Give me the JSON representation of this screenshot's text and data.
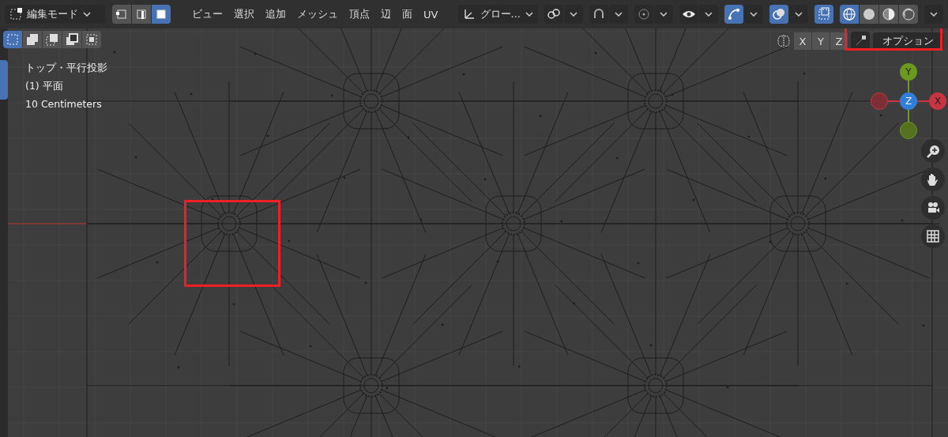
{
  "header": {
    "mode_selector": {
      "label": "編集モード"
    },
    "select_modes": [
      {
        "kind": "vertex",
        "selected": false
      },
      {
        "kind": "edge",
        "selected": false
      },
      {
        "kind": "face",
        "selected": true
      }
    ],
    "menus": [
      "ビュー",
      "選択",
      "追加",
      "メッシュ",
      "頂点",
      "辺",
      "面",
      "UV"
    ],
    "orientation": {
      "label": "グロー..."
    },
    "toggles": [
      {
        "kind": "pivot",
        "on": false
      },
      {
        "kind": "snap",
        "on": false
      },
      {
        "kind": "proportional",
        "on": false
      },
      {
        "kind": "visibility",
        "on": false
      },
      {
        "kind": "gizmo",
        "on": true
      },
      {
        "kind": "overlay",
        "on": true
      },
      {
        "kind": "xray",
        "on": true
      }
    ],
    "shading": [
      {
        "kind": "wireframe",
        "selected": true
      },
      {
        "kind": "solid",
        "selected": false
      },
      {
        "kind": "material",
        "selected": false
      },
      {
        "kind": "rendered",
        "selected": false
      }
    ]
  },
  "tool_header": {
    "select_box_modes": [
      {
        "selected": true
      },
      {
        "selected": false
      },
      {
        "selected": false
      },
      {
        "selected": false
      },
      {
        "selected": false
      }
    ],
    "mirror_axes": [
      {
        "label": "X"
      },
      {
        "label": "Y"
      },
      {
        "label": "Z"
      }
    ],
    "options": {
      "label": "オプション"
    }
  },
  "viewport": {
    "info": [
      "トップ・平行投影",
      "(1) 平面",
      "10 Centimeters"
    ],
    "gizmo": {
      "y": "Y",
      "z": "Z",
      "x": "X"
    }
  }
}
